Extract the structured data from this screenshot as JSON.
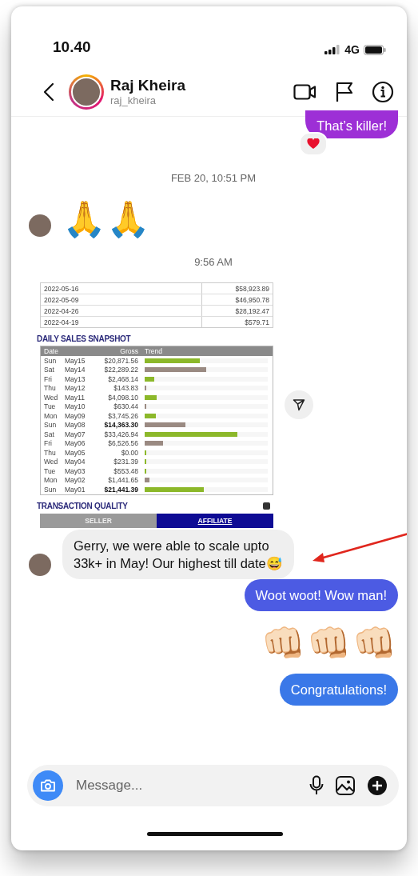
{
  "status_bar": {
    "time": "10.40",
    "network": "4G"
  },
  "header": {
    "name": "Raj Kheira",
    "username": "raj_kheira"
  },
  "messages": [
    {
      "kind": "outgoing",
      "color": "#9d2fd6",
      "text": "That’s killer!",
      "reaction": true
    },
    {
      "kind": "timestamp",
      "text": "FEB 20, 10:51 PM"
    },
    {
      "kind": "incoming-emoji",
      "text": "🙏🙏",
      "avatar": true
    },
    {
      "kind": "timestamp",
      "text": "9:56 AM"
    },
    {
      "kind": "incoming-image",
      "avatar": false,
      "report": {
        "top_rows": [
          {
            "date": "2022-05-16",
            "amount": "$58,923.89"
          },
          {
            "date": "2022-05-09",
            "amount": "$46,950.78"
          },
          {
            "date": "2022-04-26",
            "amount": "$28,192.47"
          },
          {
            "date": "2022-04-19",
            "amount": "$579.71"
          }
        ],
        "title": "DAILY SALES SNAPSHOT",
        "columns": [
          "Date",
          "Gross",
          "Trend"
        ],
        "rows": [
          {
            "day": "Sun",
            "date": "May15",
            "gross": "$20,871.56",
            "bold": false,
            "level": 0.45,
            "color": "#8cb82a"
          },
          {
            "day": "Sat",
            "date": "May14",
            "gross": "$22,289.22",
            "bold": false,
            "level": 0.5,
            "color": "#9a8a82"
          },
          {
            "day": "Fri",
            "date": "May13",
            "gross": "$2,468.14",
            "bold": false,
            "level": 0.08,
            "color": "#8cb82a"
          },
          {
            "day": "Thu",
            "date": "May12",
            "gross": "$143.83",
            "bold": false,
            "level": 0.015,
            "color": "#9a8a82"
          },
          {
            "day": "Wed",
            "date": "May11",
            "gross": "$4,098.10",
            "bold": false,
            "level": 0.1,
            "color": "#8cb82a"
          },
          {
            "day": "Tue",
            "date": "May10",
            "gross": "$630.44",
            "bold": false,
            "level": 0.015,
            "color": "#9a8a82"
          },
          {
            "day": "Mon",
            "date": "May09",
            "gross": "$3,745.26",
            "bold": false,
            "level": 0.09,
            "color": "#8cb82a"
          },
          {
            "day": "Sun",
            "date": "May08",
            "gross": "$14,363.30",
            "bold": true,
            "level": 0.33,
            "color": "#9a8a82"
          },
          {
            "day": "Sat",
            "date": "May07",
            "gross": "$33,426.94",
            "bold": false,
            "level": 0.75,
            "color": "#8cb82a"
          },
          {
            "day": "Fri",
            "date": "May06",
            "gross": "$6,526.56",
            "bold": false,
            "level": 0.15,
            "color": "#9a8a82"
          },
          {
            "day": "Thu",
            "date": "May05",
            "gross": "$0.00",
            "bold": false,
            "level": 0.015,
            "color": "#8cb82a"
          },
          {
            "day": "Wed",
            "date": "May04",
            "gross": "$231.39",
            "bold": false,
            "level": 0.015,
            "color": "#8cb82a"
          },
          {
            "day": "Tue",
            "date": "May03",
            "gross": "$553.48",
            "bold": false,
            "level": 0.015,
            "color": "#8cb82a"
          },
          {
            "day": "Mon",
            "date": "May02",
            "gross": "$1,441.65",
            "bold": false,
            "level": 0.04,
            "color": "#9a8a82"
          },
          {
            "day": "Sun",
            "date": "May01",
            "gross": "$21,441.39",
            "bold": true,
            "level": 0.48,
            "color": "#8cb82a"
          }
        ],
        "section": "TRANSACTION QUALITY",
        "segments": [
          {
            "label": "SELLER",
            "selected": false
          },
          {
            "label": "AFFILIATE",
            "selected": true
          }
        ]
      }
    },
    {
      "kind": "incoming",
      "avatar": true,
      "text": "Gerry, we were able to scale upto 33k+ in May! Our highest till date😅"
    },
    {
      "kind": "outgoing",
      "color": "#4c5be3",
      "text": "Woot woot! Wow man!",
      "reaction": false
    },
    {
      "kind": "outgoing-emoji",
      "text": "👊🏻👊🏻👊🏻"
    },
    {
      "kind": "outgoing",
      "color": "#3a78e8",
      "text": "Congratulations!",
      "reaction": false
    }
  ],
  "composer": {
    "placeholder": "Message..."
  }
}
